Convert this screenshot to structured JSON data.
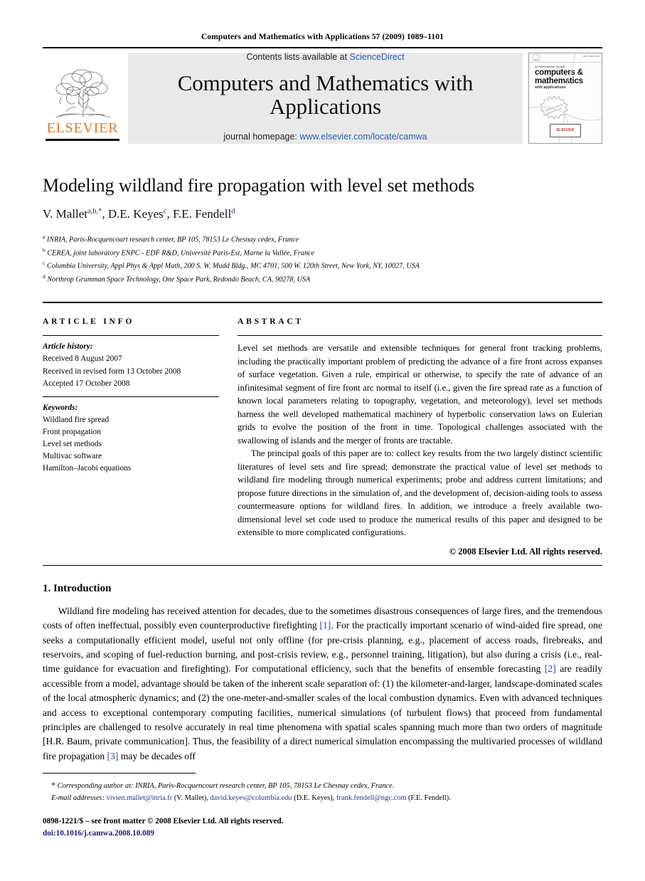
{
  "running_head": "Computers and Mathematics with Applications 57 (2009) 1089–1101",
  "masthead": {
    "contents_prefix": "Contents lists available at ",
    "contents_link": "ScienceDirect",
    "journal_title": "Computers and Mathematics with Applications",
    "homepage_prefix": "journal homepage: ",
    "homepage_link": "www.elsevier.com/locate/camwa",
    "publisher_wordmark": "ELSEVIER",
    "link_color": "#2a5db0",
    "brand_color": "#e87722",
    "panel_color": "#e9e9e9"
  },
  "cover": {
    "issn_note": "ISSN 0898-1221",
    "supertitle": "An International Journal",
    "title_line1": "computers &",
    "title_line2": "mathematics",
    "subtitle": "with applications",
    "seal_text": "available online at www.sciencedirect.com",
    "badge_line1": "Published by",
    "badge_line2": "ELSEVIER"
  },
  "article": {
    "title": "Modeling wildland fire propagation with level set methods",
    "authors_html": "V. Mallet<sup>a,b,</sup><sup>*</sup>, D.E. Keyes<sup>c</sup>, F.E. Fendell<sup>d</sup>",
    "affiliations": [
      {
        "marker": "a",
        "text": "INRIA, Paris-Rocquencourt research center, BP 105, 78153 Le Chesnay cedex, France"
      },
      {
        "marker": "b",
        "text": "CEREA, joint laboratory ENPC - EDF R&D, Université Paris-Est, Marne la Vallée, France"
      },
      {
        "marker": "c",
        "text": "Columbia University, Appl Phys & Appl Math, 200 S. W. Mudd Bldg., MC 4701, 500 W. 120th Street, New York, NY, 10027, USA"
      },
      {
        "marker": "d",
        "text": "Northrop Grumman Space Technology, One Space Park, Redondo Beach, CA, 90278, USA"
      }
    ]
  },
  "article_info": {
    "heading": "ARTICLE INFO",
    "history_label": "Article history:",
    "history": [
      "Received 8 August 2007",
      "Received in revised form 13 October 2008",
      "Accepted 17 October 2008"
    ],
    "keywords_label": "Keywords:",
    "keywords": [
      "Wildland fire spread",
      "Front propagation",
      "Level set methods",
      "Multivac software",
      "Hamilton–Jacobi equations"
    ]
  },
  "abstract": {
    "heading": "ABSTRACT",
    "paragraph1": "Level set methods are versatile and extensible techniques for general front tracking problems, including the practically important problem of predicting the advance of a fire front across expanses of surface vegetation. Given a rule, empirical or otherwise, to specify the rate of advance of an infinitesimal segment of fire front arc normal to itself (i.e., given the fire spread rate as a function of known local parameters relating to topography, vegetation, and meteorology), level set methods harness the well developed mathematical machinery of hyperbolic conservation laws on Eulerian grids to evolve the position of the front in time. Topological challenges associated with the swallowing of islands and the merger of fronts are tractable.",
    "paragraph2": "The principal goals of this paper are to: collect key results from the two largely distinct scientific literatures of level sets and fire spread; demonstrate the practical value of level set methods to wildland fire modeling through numerical experiments; probe and address current limitations; and propose future directions in the simulation of, and the development of, decision-aiding tools to assess countermeasure options for wildland fires. In addition, we introduce a freely available two-dimensional level set code used to produce the numerical results of this paper and designed to be extensible to more complicated configurations.",
    "copyright": "© 2008 Elsevier Ltd. All rights reserved."
  },
  "introduction": {
    "heading": "1. Introduction",
    "paragraph_part1": "Wildland fire modeling has received attention for decades, due to the sometimes disastrous consequences of large fires, and the tremendous costs of often ineffectual, possibly even counterproductive firefighting ",
    "cite1": "[1]",
    "paragraph_part2": ". For the practically important scenario of wind-aided fire spread, one seeks a computationally efficient model, useful not only offline (for pre-crisis planning, e.g., placement of access roads, firebreaks, and reservoirs, and scoping of fuel-reduction burning, and post-crisis review, e.g., personnel training, litigation), but also during a crisis (i.e., real-time guidance for evacuation and firefighting). For computational efficiency, such that the benefits of ensemble forecasting ",
    "cite2": "[2]",
    "paragraph_part3": " are readily accessible from a model, advantage should be taken of the inherent scale separation of: (1) the kilometer-and-larger, landscape-dominated scales of the local atmospheric dynamics; and (2) the one-meter-and-smaller scales of the local combustion dynamics. Even with advanced techniques and access to exceptional contemporary computing facilities, numerical simulations (of turbulent flows) that proceed from fundamental principles are challenged to resolve accurately in real time phenomena with spatial scales spanning much more than two orders of magnitude [H.R. Baum, private communication]. Thus, the feasibility of a direct numerical simulation encompassing the multivaried processes of wildland fire propagation ",
    "cite3": "[3]",
    "paragraph_part4": " may be decades off"
  },
  "footer": {
    "corresponding_star": "*",
    "corresponding_note": "Corresponding author at: INRIA, Paris-Rocquencourt research center, BP 105, 78153 Le Chesnay cedex, France.",
    "email_label": "E-mail addresses:",
    "emails": [
      {
        "address": "vivien.mallet@inria.fr",
        "owner": "(V. Mallet)"
      },
      {
        "address": "david.keyes@columbia.edu",
        "owner": "(D.E. Keyes)"
      },
      {
        "address": "frank.fendell@ngc.com",
        "owner": "(F.E. Fendell)"
      }
    ],
    "issn_line": "0898-1221/$ – see front matter © 2008 Elsevier Ltd. All rights reserved.",
    "doi_line": "doi:10.1016/j.camwa.2008.10.089"
  }
}
